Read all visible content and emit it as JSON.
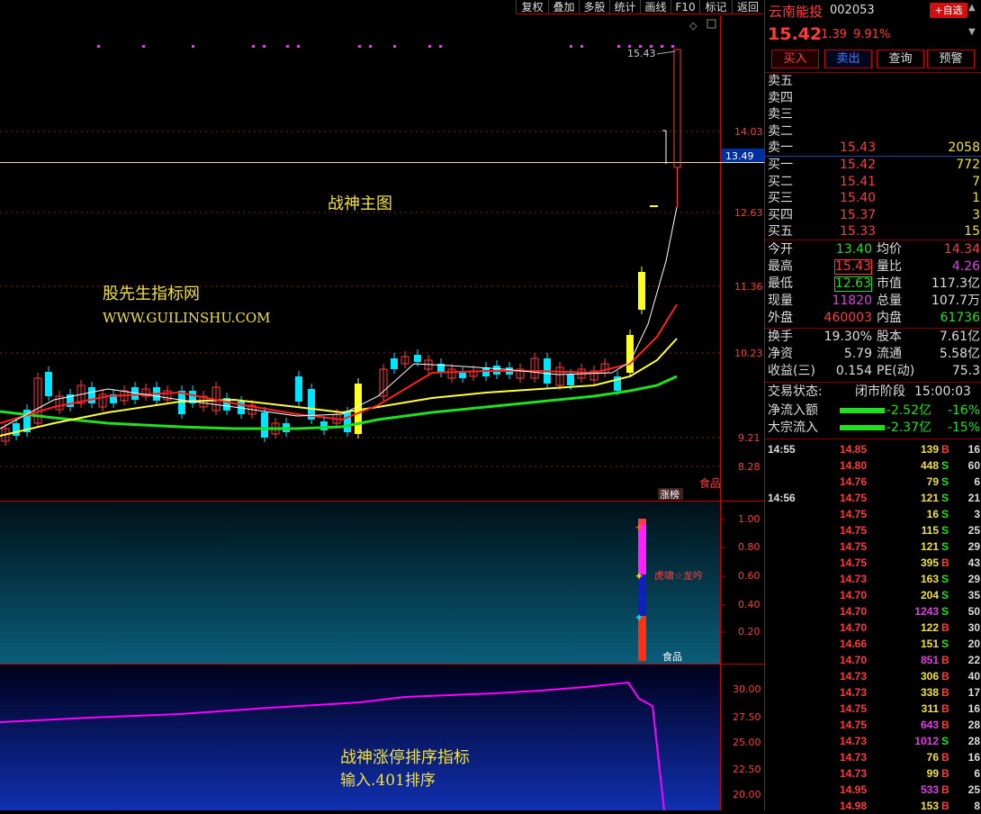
{
  "toolbar": {
    "items": [
      "复权",
      "叠加",
      "多股",
      "统计",
      "画线",
      "F10",
      "标记",
      "返回"
    ]
  },
  "main_chart": {
    "title": "战神主图",
    "watermark_name": "股先生指标网",
    "watermark_url": "WWW.GUILINSHU.COM",
    "y_labels": [
      "14.03",
      "12.63",
      "11.36",
      "10.23",
      "9.21",
      "8.28"
    ],
    "cursor_price": "13.49",
    "high_marker": "15.43",
    "sector_label": "食品",
    "limit_badge": "涨榜"
  },
  "panel2": {
    "y_labels": [
      "1.00",
      "0.80",
      "0.60",
      "0.40",
      "0.20"
    ],
    "signal_text": "虎啸☆龙吟",
    "sector_label": "食品"
  },
  "panel3": {
    "y_labels": [
      "30.00",
      "27.50",
      "25.00",
      "22.50",
      "20.00"
    ],
    "title_line1": "战神涨停排序指标",
    "title_line2": "输入.401排序"
  },
  "quote": {
    "name": "云南能投",
    "code": "002053",
    "add_fav": "+自选",
    "price": "15.42",
    "change": "1.39",
    "change_pct": "9.91%",
    "buttons": [
      "买入",
      "卖出",
      "查询",
      "预警"
    ]
  },
  "order_book": {
    "asks": [
      {
        "label": "卖五",
        "price": "",
        "vol": ""
      },
      {
        "label": "卖四",
        "price": "",
        "vol": ""
      },
      {
        "label": "卖三",
        "price": "",
        "vol": ""
      },
      {
        "label": "卖二",
        "price": "",
        "vol": ""
      },
      {
        "label": "卖一",
        "price": "15.43",
        "vol": "2058"
      }
    ],
    "bids": [
      {
        "label": "买一",
        "price": "15.42",
        "vol": "772"
      },
      {
        "label": "买二",
        "price": "15.41",
        "vol": "7"
      },
      {
        "label": "买三",
        "price": "15.40",
        "vol": "1"
      },
      {
        "label": "买四",
        "price": "15.37",
        "vol": "3"
      },
      {
        "label": "买五",
        "price": "15.33",
        "vol": "15"
      }
    ]
  },
  "stats": {
    "open_label": "今开",
    "open": "13.40",
    "avg_label": "均价",
    "avg": "14.34",
    "high_label": "最高",
    "high": "15.43",
    "vr_label": "量比",
    "vr": "4.26",
    "low_label": "最低",
    "low": "12.63",
    "mcap_label": "市值",
    "mcap": "117.3亿",
    "cur_vol_label": "现量",
    "cur_vol": "11820",
    "tot_vol_label": "总量",
    "tot_vol": "107.7万",
    "outer_label": "外盘",
    "outer": "460003",
    "inner_label": "内盘",
    "inner": "61736",
    "turnover_label": "换手",
    "turnover": "19.30%",
    "share_label": "股本",
    "share": "7.61亿",
    "nav_label": "净资",
    "nav": "5.79",
    "float_label": "流通",
    "float": "5.58亿",
    "eps_label": "收益(三)",
    "eps": "0.154",
    "pe_label": "PE(动)",
    "pe": "75.3"
  },
  "status": {
    "label": "交易状态:",
    "phase": "闭市阶段",
    "time": "15:00:03"
  },
  "flows": [
    {
      "label": "净流入额",
      "value": "-2.52亿",
      "pct": "-16%"
    },
    {
      "label": "大宗流入",
      "value": "-2.37亿",
      "pct": "-15%"
    }
  ],
  "ticks": [
    {
      "time": "14:55",
      "price": "14.85",
      "vol": "139",
      "side": "B",
      "n": "16"
    },
    {
      "time": "",
      "price": "14.80",
      "vol": "448",
      "side": "S",
      "n": "60"
    },
    {
      "time": "",
      "price": "14.76",
      "vol": "79",
      "side": "S",
      "n": "6"
    },
    {
      "time": "14:56",
      "price": "14.75",
      "vol": "121",
      "side": "S",
      "n": "21"
    },
    {
      "time": "",
      "price": "14.75",
      "vol": "16",
      "side": "S",
      "n": "3"
    },
    {
      "time": "",
      "price": "14.75",
      "vol": "115",
      "side": "S",
      "n": "25"
    },
    {
      "time": "",
      "price": "14.75",
      "vol": "121",
      "side": "S",
      "n": "29"
    },
    {
      "time": "",
      "price": "14.75",
      "vol": "395",
      "side": "B",
      "n": "43"
    },
    {
      "time": "",
      "price": "14.73",
      "vol": "163",
      "side": "S",
      "n": "29"
    },
    {
      "time": "",
      "price": "14.70",
      "vol": "204",
      "side": "S",
      "n": "35"
    },
    {
      "time": "",
      "price": "14.70",
      "vol": "1243",
      "side": "S",
      "n": "50"
    },
    {
      "time": "",
      "price": "14.70",
      "vol": "122",
      "side": "B",
      "n": "30"
    },
    {
      "time": "",
      "price": "14.66",
      "vol": "151",
      "side": "S",
      "n": "20"
    },
    {
      "time": "",
      "price": "14.70",
      "vol": "851",
      "side": "B",
      "n": "22"
    },
    {
      "time": "",
      "price": "14.73",
      "vol": "306",
      "side": "B",
      "n": "40"
    },
    {
      "time": "",
      "price": "14.73",
      "vol": "338",
      "side": "B",
      "n": "17"
    },
    {
      "time": "",
      "price": "14.75",
      "vol": "311",
      "side": "B",
      "n": "16"
    },
    {
      "time": "",
      "price": "14.75",
      "vol": "643",
      "side": "B",
      "n": "28"
    },
    {
      "time": "",
      "price": "14.73",
      "vol": "1012",
      "side": "S",
      "n": "28"
    },
    {
      "time": "",
      "price": "14.73",
      "vol": "76",
      "side": "B",
      "n": "16"
    },
    {
      "time": "",
      "price": "14.73",
      "vol": "99",
      "side": "B",
      "n": "6"
    },
    {
      "time": "",
      "price": "14.95",
      "vol": "533",
      "side": "B",
      "n": "25"
    },
    {
      "time": "",
      "price": "14.98",
      "vol": "153",
      "side": "B",
      "n": "8"
    }
  ],
  "colors": {
    "up": "#ff3b3b",
    "down": "#00e5ff",
    "ma5": "#ffffff",
    "ma10": "#ff2020",
    "ma20": "#ffff40",
    "ma60": "#20e020",
    "indicator": "#ff00ff",
    "text_yellow": "#f0e040"
  }
}
